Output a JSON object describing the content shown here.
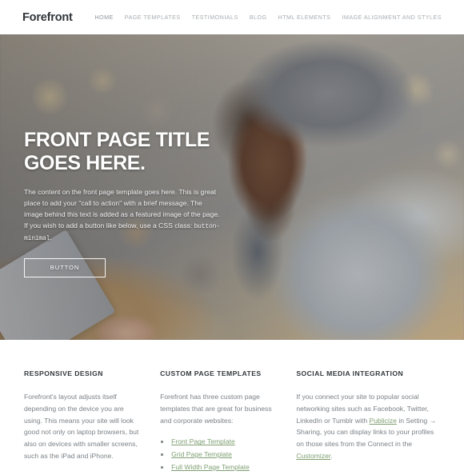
{
  "site": {
    "logo": "Forefront"
  },
  "nav": {
    "items": [
      {
        "label": "HOME",
        "active": true
      },
      {
        "label": "PAGE TEMPLATES",
        "active": false
      },
      {
        "label": "TESTIMONIALS",
        "active": false
      },
      {
        "label": "BLOG",
        "active": false
      },
      {
        "label": "HTML ELEMENTS",
        "active": false
      },
      {
        "label": "IMAGE ALIGNMENT AND STYLES",
        "active": false
      }
    ]
  },
  "hero": {
    "title_line1": "FRONT PAGE TITLE",
    "title_line2": "GOES HERE.",
    "paragraph_part1": "The content on the front page template goes here. This is great place to add your \"call to action\" with a brief message. The image behind this text is added as a featured image of the page. If you wish to add a button like below, use a CSS class: ",
    "paragraph_code": "button-minimal",
    "paragraph_part2": ".",
    "button_label": "BUTTON",
    "image_description": "Man in gray knit beanie and houndstooth scarf holding a tablet at a wooden cafe table"
  },
  "features": {
    "columns": [
      {
        "heading": "RESPONSIVE DESIGN",
        "body": "Forefront's layout adjusts itself depending on the device you are using. This means your site will look good not only on laptop browsers, but also on devices with smaller screens, such as the iPad and iPhone."
      },
      {
        "heading": "CUSTOM PAGE TEMPLATES",
        "body": "Forefront has three custom page templates that are great for business and corporate websites:",
        "links": [
          "Front Page Template",
          "Grid Page Template",
          "Full Width Page Template"
        ]
      },
      {
        "heading": "SOCIAL MEDIA INTEGRATION",
        "body_part1": "If you connect your site to popular social networking sites such as Facebook, Twitter, LinkedIn or Tumblr with ",
        "link_publicize": "Publicize",
        "body_part2": " in Setting → Sharing, you can display links to your profiles on those sites from the Connect in the ",
        "link_customizer": "Customizer",
        "body_part3": "."
      }
    ]
  },
  "colors": {
    "link_green": "#7f9f72",
    "heading_dark": "#32383c",
    "body_gray": "#7b8186",
    "nav_gray": "#a8adb2"
  }
}
